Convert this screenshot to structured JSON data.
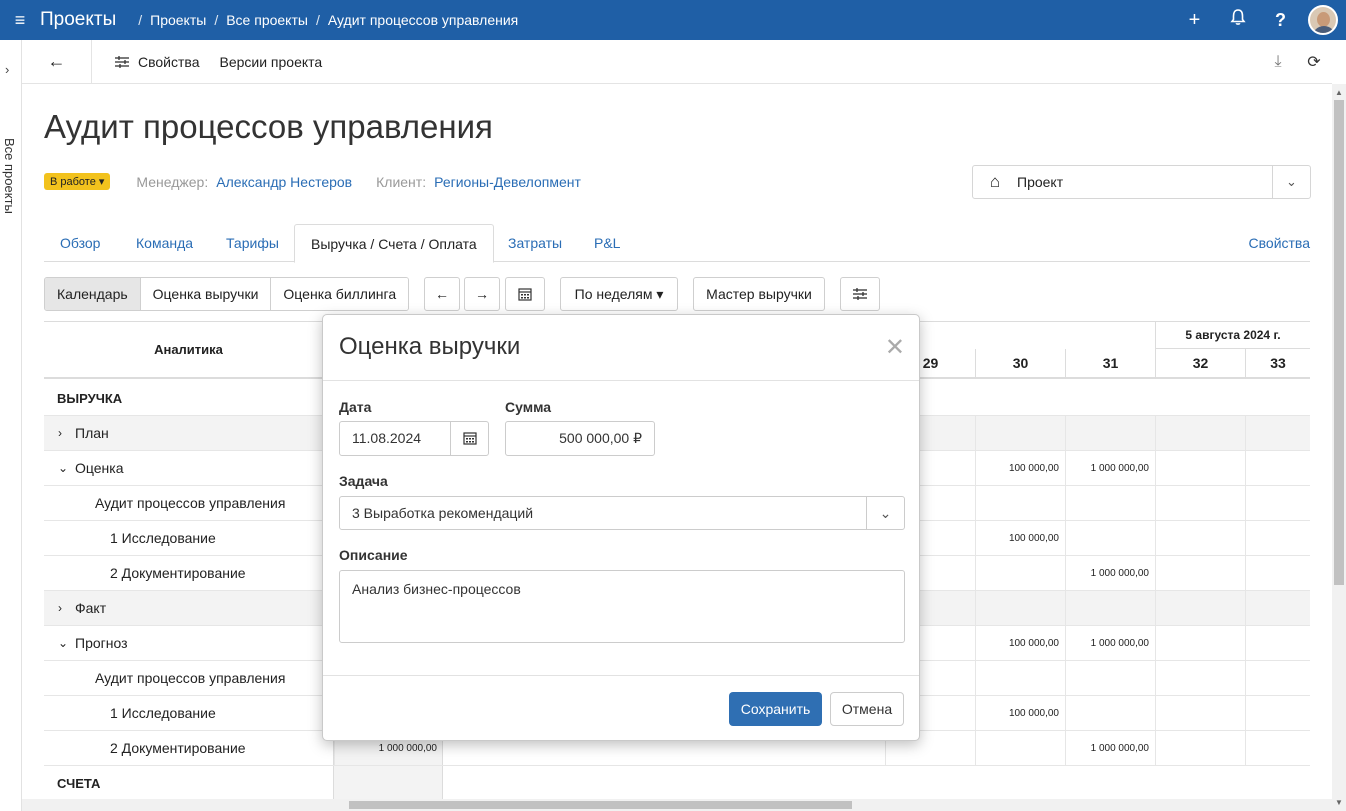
{
  "topbar": {
    "menu_icon": "hamburger-icon",
    "app_name": "Проекты",
    "breadcrumbs": [
      "Проекты",
      "Все проекты",
      "Аудит процессов управления"
    ],
    "sep": "/",
    "bg_color": "#1f5fa6"
  },
  "leftstrip": {
    "label": "Все проекты"
  },
  "toolbar": {
    "back_icon": "arrow-left-icon",
    "properties": "Свойства",
    "versions": "Версии проекта"
  },
  "project": {
    "title": "Аудит процессов управления",
    "status": "В работе",
    "manager_label": "Менеджер:",
    "manager": "Александр Нестеров",
    "client_label": "Клиент:",
    "client": "Регионы-Девелопмент",
    "type_select": "Проект"
  },
  "tabs": [
    {
      "label": "Обзор"
    },
    {
      "label": "Команда"
    },
    {
      "label": "Тарифы"
    },
    {
      "label": "Выручка / Счета / Оплата",
      "active": true
    },
    {
      "label": "Затраты"
    },
    {
      "label": "P&L"
    }
  ],
  "tabs_right": "Свойства",
  "views": [
    "Календарь",
    "Оценка выручки",
    "Оценка биллинга"
  ],
  "period_select": "По неделям",
  "revenue_master": "Мастер выручки",
  "grid": {
    "analytics_header": "Аналитика",
    "week_label": "5 августа 2024 г.",
    "columns": [
      "29",
      "30",
      "31",
      "32",
      "33"
    ],
    "rows": [
      {
        "label": "ВЫРУЧКА",
        "section": true
      },
      {
        "label": "План",
        "toggle": ">"
      },
      {
        "label": "Оценка",
        "toggle": "v",
        "c30": "100 000,00",
        "c31": "1 000 000,00"
      },
      {
        "label": "Аудит процессов управления"
      },
      {
        "label": "1 Исследование",
        "c30": "100 000,00"
      },
      {
        "label": "2 Документирование",
        "c31": "1 000 000,00"
      },
      {
        "label": "Факт",
        "toggle": ">"
      },
      {
        "label": "Прогноз",
        "toggle": "v",
        "c30": "100 000,00",
        "c31": "1 000 000,00"
      },
      {
        "label": "Аудит процессов управления"
      },
      {
        "label": "1 Исследование",
        "c30": "100 000,00"
      },
      {
        "label": "2 Документирование",
        "left": "1 000 000,00",
        "c31": "1 000 000,00"
      },
      {
        "label": "СЧЕТА",
        "section": true
      }
    ]
  },
  "modal": {
    "title": "Оценка выручки",
    "date_label": "Дата",
    "date_value": "11.08.2024",
    "sum_label": "Сумма",
    "sum_value": "500 000,00 ₽",
    "task_label": "Задача",
    "task_value": "3 Выработка рекомендаций",
    "desc_label": "Описание",
    "desc_value": "Анализ бизнес-процессов",
    "save": "Сохранить",
    "cancel": "Отмена",
    "primary_color": "#2f6fb3"
  }
}
